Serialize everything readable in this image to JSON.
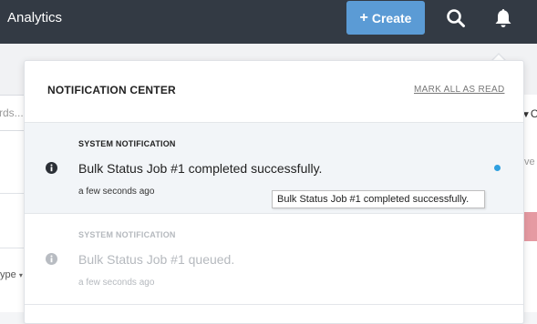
{
  "topbar": {
    "app_title": "Analytics",
    "create_label": "Create",
    "create_plus": "+",
    "icons": [
      "search-icon",
      "bell-icon"
    ]
  },
  "background": {
    "search_placeholder_fragment": "rds...",
    "type_fragment": "ype",
    "filter_fragment": "C",
    "right_text_fragment": "ve"
  },
  "notification_center": {
    "title": "NOTIFICATION CENTER",
    "mark_all_label": "MARK ALL AS READ",
    "items": [
      {
        "type": "SYSTEM NOTIFICATION",
        "message": "Bulk Status Job #1 completed successfully.",
        "time": "a few seconds ago",
        "unread": true
      },
      {
        "type": "SYSTEM NOTIFICATION",
        "message": "Bulk Status Job #1 queued.",
        "time": "a few seconds ago",
        "unread": false
      }
    ]
  },
  "tooltip": {
    "text": "Bulk Status Job #1 completed successfully."
  },
  "colors": {
    "topbar": "#333a44",
    "create_button": "#5b9bd5",
    "unread_dot": "#2fa0e0",
    "unread_bg": "#f2f5f8"
  }
}
